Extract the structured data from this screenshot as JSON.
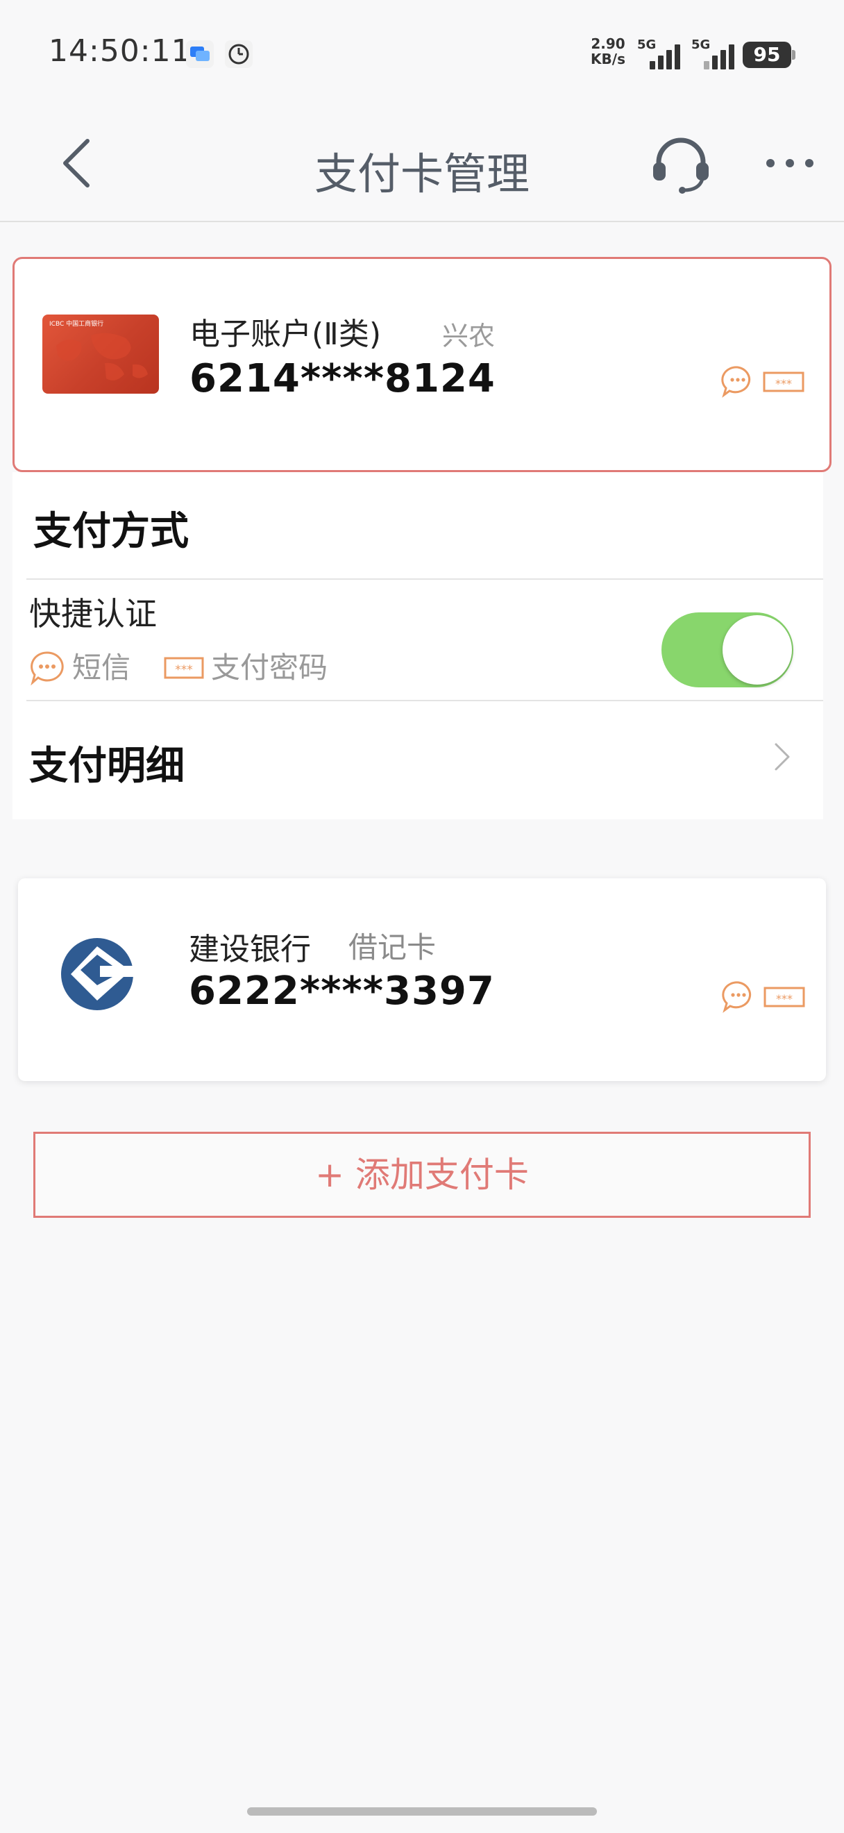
{
  "status_bar": {
    "time": "14:50:11",
    "net_speed_value": "2.90",
    "net_speed_unit": "KB/s",
    "signal1_label": "5G",
    "signal2_label": "5G",
    "battery": "95"
  },
  "header": {
    "title": "支付卡管理",
    "back_icon": "chevron-left-icon",
    "service_icon": "headset-icon",
    "more_icon": "more-dots-icon"
  },
  "cards": [
    {
      "name": "电子账户(Ⅱ类)",
      "tag": "兴农",
      "number": "6214****8124",
      "image_label": "ICBC 中国工商银行",
      "selected": true
    },
    {
      "name": "建设银行",
      "tag": "借记卡",
      "number": "6222****3397",
      "selected": false
    }
  ],
  "payment_method": {
    "title": "支付方式",
    "quick_auth_label": "快捷认证",
    "methods": [
      "短信",
      "支付密码"
    ],
    "toggle_on": true
  },
  "payment_detail": {
    "label": "支付明细"
  },
  "add_card": {
    "label": "+ 添加支付卡"
  },
  "colors": {
    "accent": "#e07a76",
    "toggle_on": "#88d66c",
    "ccb_blue": "#2f5b92"
  }
}
